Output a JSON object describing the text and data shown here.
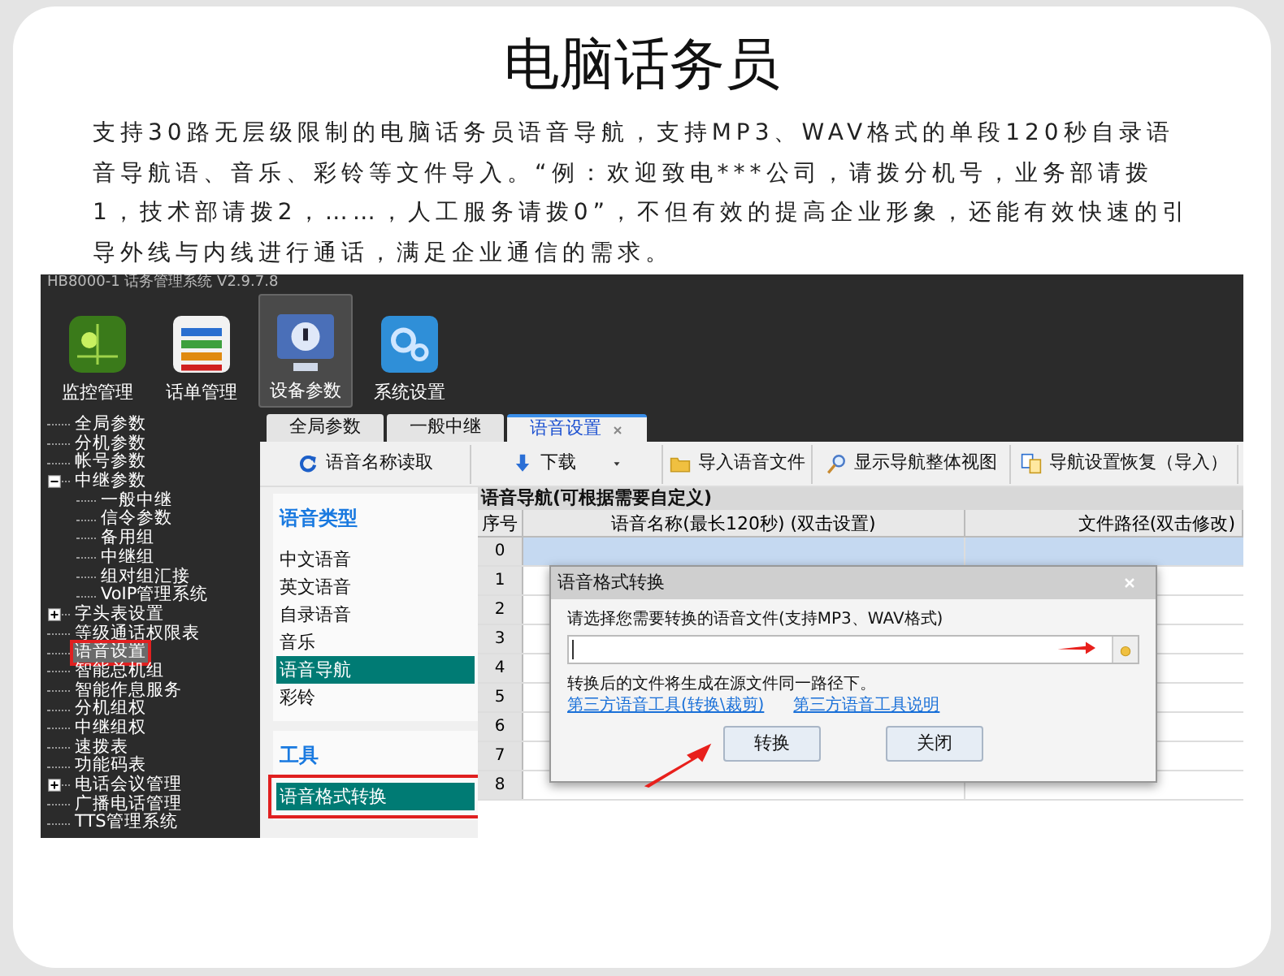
{
  "page_title": "电脑话务员",
  "description": "支持30路无层级限制的电脑话务员语音导航，支持MP3、WAV格式的单段120秒自录语音导航语、音乐、彩铃等文件导入。“例：欢迎致电***公司，请拨分机号，业务部请拨1，技术部请拨2，……，人工服务请拨0”，不但有效的提高企业形象，还能有效快速的引导外线与内线进行通话，满足企业通信的需求。",
  "app": {
    "title": "HB8000-1 话务管理系统 V2.9.7.8",
    "toolbar": [
      {
        "label": "监控管理",
        "kind": "monitor",
        "selected": false
      },
      {
        "label": "话单管理",
        "kind": "records",
        "selected": false
      },
      {
        "label": "设备参数",
        "kind": "device",
        "selected": true
      },
      {
        "label": "系统设置",
        "kind": "settings",
        "selected": false
      }
    ],
    "tree": [
      {
        "label": "全局参数",
        "selected": false
      },
      {
        "label": "分机参数",
        "selected": false
      },
      {
        "label": "帐号参数",
        "selected": false
      },
      {
        "label": "中继参数",
        "selected": false,
        "expanded": true,
        "children": [
          {
            "label": "一般中继",
            "selected": false
          },
          {
            "label": "信令参数",
            "selected": false
          },
          {
            "label": "备用组",
            "selected": false
          },
          {
            "label": "中继组",
            "selected": false
          },
          {
            "label": "组对组汇接",
            "selected": false
          },
          {
            "label": "VoIP管理系统",
            "selected": false
          }
        ]
      },
      {
        "label": "字头表设置",
        "selected": false,
        "expanded": false
      },
      {
        "label": "等级通话权限表",
        "selected": false
      },
      {
        "label": "语音设置",
        "selected": true,
        "highlighted": true
      },
      {
        "label": "智能总机组",
        "selected": false
      },
      {
        "label": "智能作息服务",
        "selected": false
      },
      {
        "label": "分机组权",
        "selected": false
      },
      {
        "label": "中继组权",
        "selected": false
      },
      {
        "label": "速拨表",
        "selected": false
      },
      {
        "label": "功能码表",
        "selected": false
      },
      {
        "label": "电话会议管理",
        "selected": false,
        "expanded": false
      },
      {
        "label": "广播电话管理",
        "selected": false
      },
      {
        "label": "TTS管理系统",
        "selected": false
      }
    ],
    "tabs": [
      {
        "label": "全局参数",
        "selected": false,
        "closable": false
      },
      {
        "label": "一般中继",
        "selected": false,
        "closable": false
      },
      {
        "label": "语音设置",
        "selected": true,
        "closable": true
      }
    ],
    "actions": [
      {
        "label": "语音名称读取",
        "kind": "refresh",
        "dropdown": false
      },
      {
        "label": "下载",
        "kind": "download",
        "dropdown": true
      },
      {
        "label": "导入语音文件",
        "kind": "folder",
        "dropdown": false
      },
      {
        "label": "显示导航整体视图",
        "kind": "zoom",
        "dropdown": false
      },
      {
        "label": "导航设置恢复（导入）",
        "kind": "restore",
        "dropdown": false
      }
    ],
    "categories": {
      "title": "语音类型",
      "items": [
        {
          "label": "中文语音",
          "selected": false
        },
        {
          "label": "英文语音",
          "selected": false
        },
        {
          "label": "自录语音",
          "selected": false
        },
        {
          "label": "音乐",
          "selected": false
        },
        {
          "label": "语音导航",
          "selected": true
        },
        {
          "label": "彩铃",
          "selected": false
        }
      ]
    },
    "tools": {
      "title": "工具",
      "items": [
        {
          "label": "语音格式转换",
          "selected": true,
          "highlighted": true
        }
      ]
    },
    "grid": {
      "title": "语音导航(可根据需要自定义)",
      "columns": [
        "序号",
        "语音名称(最长120秒) (双击设置)",
        "文件路径(双击修改)"
      ],
      "rows": [
        {
          "index": "0",
          "selected": true
        },
        {
          "index": "1",
          "selected": false
        },
        {
          "index": "2",
          "selected": false
        },
        {
          "index": "3",
          "selected": false
        },
        {
          "index": "4",
          "selected": false
        },
        {
          "index": "5",
          "selected": false
        },
        {
          "index": "6",
          "selected": false
        },
        {
          "index": "7",
          "selected": false
        },
        {
          "index": "8",
          "selected": false
        }
      ]
    },
    "dialog": {
      "title": "语音格式转换",
      "prompt": "请选择您需要转换的语音文件(支持MP3、WAV格式)",
      "note": "转换后的文件将生成在源文件同一路径下。",
      "links": [
        "第三方语音工具(转换\\裁剪)",
        "第三方语音工具说明"
      ],
      "buttons": [
        "转换",
        "关闭"
      ]
    }
  }
}
